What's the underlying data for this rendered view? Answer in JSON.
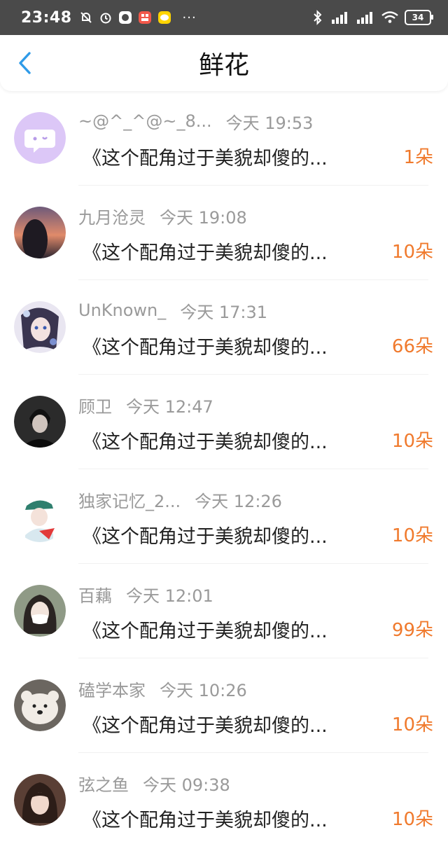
{
  "statusbar": {
    "time": "23:48",
    "battery": "34",
    "more": "···"
  },
  "header": {
    "title": "鲜花"
  },
  "colors": {
    "accent_orange": "#f07a2d",
    "back_blue": "#2f9be8",
    "meta_gray": "#9a9a9a"
  },
  "list": [
    {
      "name": "~@^_^@~_8...",
      "time": "今天 19:53",
      "message": "《这个配角过于美貌却傻的...",
      "count": "1朵",
      "avatar": "chat-bubble-avatar"
    },
    {
      "name": "九月沧灵",
      "time": "今天 19:08",
      "message": "《这个配角过于美貌却傻的...",
      "count": "10朵",
      "avatar": "sunset-avatar"
    },
    {
      "name": "UnKnown_",
      "time": "今天 17:31",
      "message": "《这个配角过于美貌却傻的...",
      "count": "66朵",
      "avatar": "anime-avatar"
    },
    {
      "name": "顾卫",
      "time": "今天 12:47",
      "message": "《这个配角过于美貌却傻的...",
      "count": "10朵",
      "avatar": "dark-portrait-avatar"
    },
    {
      "name": "独家记忆_2...",
      "time": "今天 12:26",
      "message": "《这个配角过于美貌却傻的...",
      "count": "10朵",
      "avatar": "cap-girl-avatar"
    },
    {
      "name": "百藕",
      "time": "今天 12:01",
      "message": "《这个配角过于美貌却傻的...",
      "count": "99朵",
      "avatar": "mask-girl-avatar"
    },
    {
      "name": "磕学本家",
      "time": "今天 10:26",
      "message": "《这个配角过于美貌却傻的...",
      "count": "10朵",
      "avatar": "plush-bear-avatar"
    },
    {
      "name": "弦之鱼",
      "time": "今天 09:38",
      "message": "《这个配角过于美貌却傻的...",
      "count": "10朵",
      "avatar": "girl-portrait-avatar"
    }
  ]
}
